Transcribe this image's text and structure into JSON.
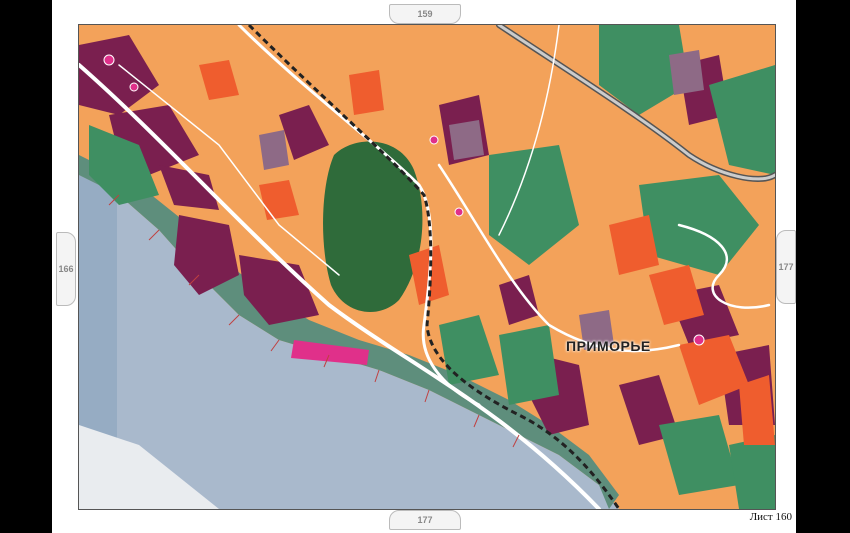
{
  "sheet": {
    "label_prefix": "Лист",
    "number": "160"
  },
  "neighbors": {
    "top": "159",
    "bottom": "177",
    "left": "166",
    "right": "177"
  },
  "map": {
    "place_label": "ПРИМОРЬЕ"
  },
  "colors": {
    "sea": "#a9b9cc",
    "residential": "#f3a25a",
    "dense": "#7a1f4f",
    "green": "#3f8f62",
    "forest": "#2f6b3a",
    "commercial": "#ef5d2e",
    "special": "#e0308a",
    "beach": "#5e8e7c",
    "road": "#ffffff"
  }
}
